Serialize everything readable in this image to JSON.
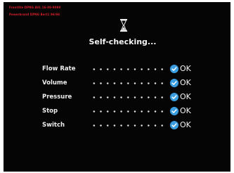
{
  "header": {
    "version_line_1": "Frontlite DPNG AVL 16-09-9089",
    "version_line_2": "Powerbrand DPNG Bert1 96/96"
  },
  "title": "Self-checking...",
  "checks": [
    {
      "label": "Flow Rate",
      "status": "OK"
    },
    {
      "label": "Volume",
      "status": "OK"
    },
    {
      "label": "Pressure",
      "status": "OK"
    },
    {
      "label": "Stop",
      "status": "OK"
    },
    {
      "label": "Switch",
      "status": "OK"
    }
  ],
  "icons": {
    "busy": "hourglass-icon",
    "status": "check-circle-icon"
  },
  "colors": {
    "background": "#050505",
    "version_text": "#d5202a",
    "text": "#f0f0f0",
    "check_accent": "#3a9de0"
  }
}
